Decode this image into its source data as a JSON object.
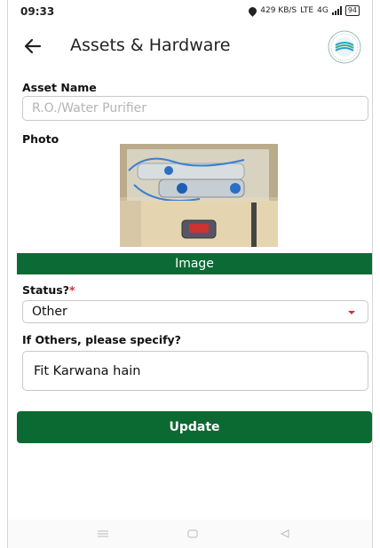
{
  "status_bar": {
    "time": "09:33",
    "network_speed": "429 KB/S",
    "network_type": "LTE",
    "signal": "4G",
    "battery": "94"
  },
  "app_bar": {
    "title": "Assets & Hardware",
    "back_icon": "arrow-left-icon",
    "logo_icon": "organization-logo"
  },
  "form": {
    "asset_name": {
      "label": "Asset Name",
      "value": "R.O./Water Purifier"
    },
    "photo": {
      "label": "Photo",
      "image_description_icon": "water-purifier-photo"
    },
    "image_bar_label": "Image",
    "status": {
      "label": "Status?",
      "required_mark": "*",
      "selected": "Other"
    },
    "others": {
      "label": "If Others, please specify?",
      "value": "Fit Karwana hain"
    },
    "update_button": "Update"
  },
  "colors": {
    "primary_green": "#0b6a32",
    "required_red": "#d32f2f"
  },
  "nav_bar": {
    "icons": [
      "menu-icon",
      "home-icon",
      "back-triangle-icon"
    ]
  }
}
